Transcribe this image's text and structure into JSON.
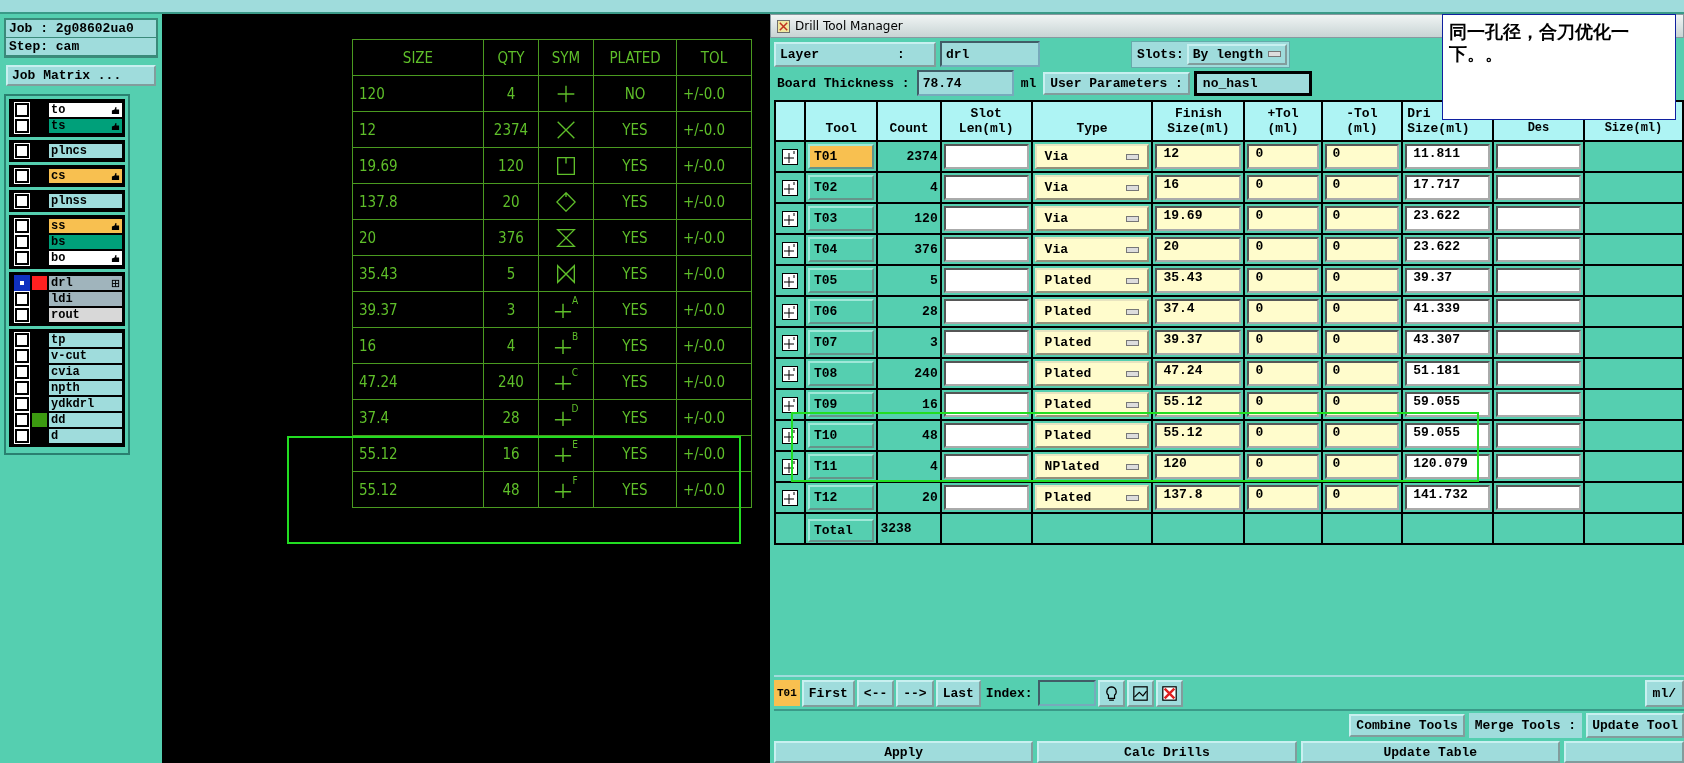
{
  "job": {
    "job": "Job : 2g08602ua0",
    "step": "Step: cam",
    "matrix_button": "Job Matrix ..."
  },
  "layer_groups": [
    {
      "layers": [
        {
          "name": "to",
          "color": "#ffffff",
          "hand": true,
          "selected": false
        },
        {
          "name": "ts",
          "color": "#00a07a",
          "hand": true,
          "selected": false
        }
      ]
    },
    {
      "layers": [
        {
          "name": "plncs",
          "color": "#9fdcdc",
          "hand": false,
          "selected": false
        }
      ]
    },
    {
      "layers": [
        {
          "name": "cs",
          "color": "#f8c050",
          "hand": true,
          "selected": false
        }
      ]
    },
    {
      "layers": [
        {
          "name": "plnss",
          "color": "#9fdcdc",
          "hand": false,
          "selected": false
        }
      ]
    },
    {
      "layers": [
        {
          "name": "ss",
          "color": "#f8c050",
          "hand": true,
          "selected": false
        },
        {
          "name": "bs",
          "color": "#00a07a",
          "hand": false,
          "selected": false
        },
        {
          "name": "bo",
          "color": "#ffffff",
          "hand": true,
          "selected": false
        }
      ]
    },
    {
      "layers": [
        {
          "name": "drl",
          "color": "#a0b4bc",
          "hand": false,
          "selected": true,
          "swatch": {
            "color": "#ff2020"
          },
          "grid": true
        },
        {
          "name": "ldi",
          "color": "#a0b4bc",
          "hand": false,
          "selected": false
        },
        {
          "name": "rout",
          "color": "#d8d8d8",
          "hand": false,
          "selected": false
        }
      ]
    },
    {
      "layers": [
        {
          "name": "tp",
          "color": "#9fdcdc",
          "hand": false,
          "selected": false
        },
        {
          "name": "v-cut",
          "color": "#9fdcdc",
          "hand": false,
          "selected": false
        },
        {
          "name": "cvia",
          "color": "#9fdcdc",
          "hand": false,
          "selected": false
        },
        {
          "name": "npth",
          "color": "#9fdcdc",
          "hand": false,
          "selected": false
        },
        {
          "name": "ydkdrl",
          "color": "#9fdcdc",
          "hand": false,
          "selected": false
        },
        {
          "name": "dd",
          "color": "#9fdcdc",
          "hand": false,
          "selected": false,
          "swatch": {
            "color": "#3c9a10"
          }
        },
        {
          "name": "d",
          "color": "#9fdcdc",
          "hand": false,
          "selected": false
        }
      ]
    }
  ],
  "drill_chart": {
    "columns": [
      "SIZE",
      "QTY",
      "SYM",
      "PLATED",
      "TOL"
    ],
    "rows": [
      {
        "size": "120",
        "qty": "4",
        "kind": "plus",
        "plated": "NO",
        "tol": "+/-0.0"
      },
      {
        "size": "12",
        "qty": "2374",
        "kind": "x",
        "plated": "YES",
        "tol": "+/-0.0"
      },
      {
        "size": "19.69",
        "qty": "120",
        "kind": "square",
        "plated": "YES",
        "tol": "+/-0.0"
      },
      {
        "size": "137.8",
        "qty": "20",
        "kind": "diamond",
        "plated": "YES",
        "tol": "+/-0.0"
      },
      {
        "size": "20",
        "qty": "376",
        "kind": "hourglass",
        "plated": "YES",
        "tol": "+/-0.0"
      },
      {
        "size": "35.43",
        "qty": "5",
        "kind": "bowtie",
        "plated": "YES",
        "tol": "+/-0.0"
      },
      {
        "size": "39.37",
        "qty": "3",
        "kind": "lettered",
        "letter": "A",
        "plated": "YES",
        "tol": "+/-0.0"
      },
      {
        "size": "16",
        "qty": "4",
        "kind": "lettered",
        "letter": "B",
        "plated": "YES",
        "tol": "+/-0.0"
      },
      {
        "size": "47.24",
        "qty": "240",
        "kind": "lettered",
        "letter": "C",
        "plated": "YES",
        "tol": "+/-0.0"
      },
      {
        "size": "37.4",
        "qty": "28",
        "kind": "lettered",
        "letter": "D",
        "plated": "YES",
        "tol": "+/-0.0"
      },
      {
        "size": "55.12",
        "qty": "16",
        "kind": "lettered",
        "letter": "E",
        "plated": "YES",
        "tol": "+/-0.0"
      },
      {
        "size": "55.12",
        "qty": "48",
        "kind": "lettered",
        "letter": "F",
        "plated": "YES",
        "tol": "+/-0.0"
      }
    ]
  },
  "dialog": {
    "title": "Drill Tool Manager",
    "layer_label": "Layer          :",
    "layer_value": "drl",
    "slots_label": "Slots:",
    "slots_value": "By length",
    "thickness_label": "Board Thickness :",
    "thickness_value": "78.74",
    "thickness_unit": "ml",
    "user_params_button": "User Parameters :",
    "user_params_value": "no_hasl",
    "columns": [
      {
        "bottom": "Tool"
      },
      {
        "bottom": "Count"
      },
      {
        "top": "Slot",
        "bottom": "Len(ml)"
      },
      {
        "bottom": "Type"
      },
      {
        "top": "Finish",
        "bottom": "Size(ml)"
      },
      {
        "top": "+Tol",
        "bottom": "(ml)"
      },
      {
        "top": "-Tol",
        "bottom": "(ml)"
      },
      {
        "top": "Dri",
        "bottom": "Size(ml)"
      },
      {
        "bottom": "Des"
      },
      {
        "bottom": "Size(ml)"
      }
    ],
    "tools": [
      {
        "tool": "T01",
        "count": "2374",
        "type": "Via",
        "finish": "12",
        "plus_tol": "0",
        "minus_tol": "0",
        "drill": "11.811",
        "selected": true
      },
      {
        "tool": "T02",
        "count": "4",
        "type": "Via",
        "finish": "16",
        "plus_tol": "0",
        "minus_tol": "0",
        "drill": "17.717",
        "selected": false
      },
      {
        "tool": "T03",
        "count": "120",
        "type": "Via",
        "finish": "19.69",
        "plus_tol": "0",
        "minus_tol": "0",
        "drill": "23.622",
        "selected": false
      },
      {
        "tool": "T04",
        "count": "376",
        "type": "Via",
        "finish": "20",
        "plus_tol": "0",
        "minus_tol": "0",
        "drill": "23.622",
        "selected": false
      },
      {
        "tool": "T05",
        "count": "5",
        "type": "Plated",
        "finish": "35.43",
        "plus_tol": "0",
        "minus_tol": "0",
        "drill": "39.37",
        "selected": false
      },
      {
        "tool": "T06",
        "count": "28",
        "type": "Plated",
        "finish": "37.4",
        "plus_tol": "0",
        "minus_tol": "0",
        "drill": "41.339",
        "selected": false
      },
      {
        "tool": "T07",
        "count": "3",
        "type": "Plated",
        "finish": "39.37",
        "plus_tol": "0",
        "minus_tol": "0",
        "drill": "43.307",
        "selected": false
      },
      {
        "tool": "T08",
        "count": "240",
        "type": "Plated",
        "finish": "47.24",
        "plus_tol": "0",
        "minus_tol": "0",
        "drill": "51.181",
        "selected": false
      },
      {
        "tool": "T09",
        "count": "16",
        "type": "Plated",
        "finish": "55.12",
        "plus_tol": "0",
        "minus_tol": "0",
        "drill": "59.055",
        "selected": false
      },
      {
        "tool": "T10",
        "count": "48",
        "type": "Plated",
        "finish": "55.12",
        "plus_tol": "0",
        "minus_tol": "0",
        "drill": "59.055",
        "selected": false
      },
      {
        "tool": "T11",
        "count": "4",
        "type": "NPlated",
        "finish": "120",
        "plus_tol": "0",
        "minus_tol": "0",
        "drill": "120.079",
        "selected": false
      },
      {
        "tool": "T12",
        "count": "20",
        "type": "Plated",
        "finish": "137.8",
        "plus_tol": "0",
        "minus_tol": "0",
        "drill": "141.732",
        "selected": false
      }
    ],
    "total_label": "Total",
    "total_count": "3238",
    "current_tool": "T01",
    "nav_buttons": [
      "First",
      "<--",
      "-->",
      "Last"
    ],
    "index_label": "Index:",
    "units_button": "ml/",
    "combine_button": "Combine Tools",
    "merge_label": "Merge Tools :",
    "update_tools_button": "Update Tool",
    "bottom_buttons": [
      "Apply",
      "Calc Drills",
      "Update Table"
    ]
  },
  "note": "同一孔径，合刀优化一下。。"
}
